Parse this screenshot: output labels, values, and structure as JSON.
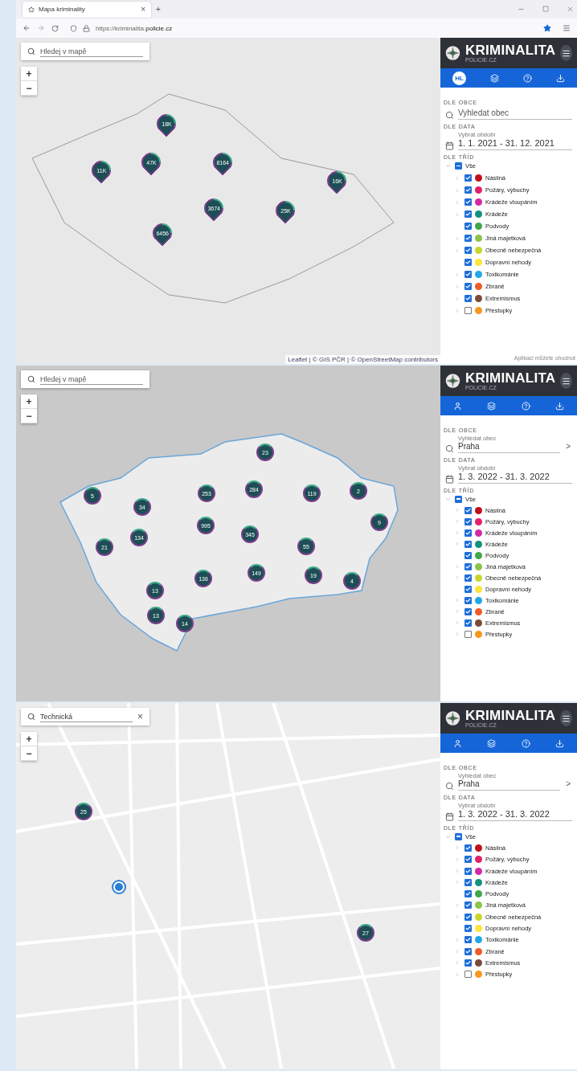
{
  "browser": {
    "tab_title": "Mapa kriminality",
    "tab_close": "×",
    "new_tab": "+",
    "url": "https://kriminalita.**policie.cz**"
  },
  "panels": [
    {
      "map": {
        "search": {
          "placeholder": "Hledej v mapě"
        },
        "zoom_in": "+",
        "zoom_out": "−",
        "attribution": "Leaflet | © GIS PČR | © OpenStreetMap contributors",
        "markers": [
          {
            "kind": "pin",
            "count": "18K"
          },
          {
            "kind": "pin",
            "count": "11K"
          },
          {
            "kind": "pin",
            "count": "47K"
          },
          {
            "kind": "pin",
            "count": "8164"
          },
          {
            "kind": "pin",
            "count": "16K"
          },
          {
            "kind": "pin",
            "count": "3674"
          },
          {
            "kind": "pin",
            "count": "25K"
          },
          {
            "kind": "pin",
            "count": "6456"
          }
        ]
      },
      "sidebar": {
        "brand": "KRIMINALITA",
        "brand_sub": "POLICIE.CZ",
        "toolbar": [
          {
            "kind": "badge",
            "label": "HL"
          },
          {
            "kind": "layers"
          },
          {
            "kind": "help"
          },
          {
            "kind": "download"
          }
        ],
        "municipality": {
          "heading": "DLE OBCE",
          "placeholder": "Vyhledat obec"
        },
        "date": {
          "heading": "DLE DATA",
          "label": "Vybrat období",
          "value": "1. 1. 2021 - 31. 12. 2021"
        },
        "classes": {
          "heading": "DLE TŘÍD",
          "root": {
            "label": "Vše",
            "expanded": true,
            "indeterminate": true,
            "children": [
              {
                "label": "Násilná",
                "color": "#c0101a",
                "checked": true,
                "has_children": true
              },
              {
                "label": "Požáry, výbuchy",
                "color": "#e0216b",
                "checked": true,
                "has_children": true
              },
              {
                "label": "Krádeže vloupáním",
                "color": "#d22aa6",
                "checked": true,
                "has_children": true
              },
              {
                "label": "Krádeže",
                "color": "#13907e",
                "checked": true,
                "has_children": true
              },
              {
                "label": "Podvody",
                "color": "#3ea84a",
                "checked": true,
                "has_children": false
              },
              {
                "label": "Jiná majetková",
                "color": "#8cc34a",
                "checked": true,
                "has_children": true
              },
              {
                "label": "Obecně nebezpečná",
                "color": "#c8d62c",
                "checked": true,
                "has_children": true
              },
              {
                "label": "Dopravní nehody",
                "color": "#fbe53a",
                "checked": true,
                "has_children": false
              },
              {
                "label": "Toxikománie",
                "color": "#22a8e8",
                "checked": true,
                "has_children": true
              },
              {
                "label": "Zbraně",
                "color": "#ee5a2a",
                "checked": true,
                "has_children": true
              },
              {
                "label": "Extremismus",
                "color": "#7a4a3a",
                "checked": true,
                "has_children": true
              },
              {
                "label": "Přestupky",
                "color": "#f7981e",
                "checked": false,
                "has_children": true
              }
            ]
          }
        },
        "footer": "Aplikaci můžete ohodnot"
      }
    },
    {
      "map": {
        "search": {
          "placeholder": "Hledej v mapě"
        },
        "zoom_in": "+",
        "zoom_out": "−",
        "markers": [
          {
            "kind": "cluster",
            "count": "23"
          },
          {
            "kind": "cluster",
            "count": "5"
          },
          {
            "kind": "cluster",
            "count": "34"
          },
          {
            "kind": "cluster",
            "count": "253"
          },
          {
            "kind": "cluster",
            "count": "284"
          },
          {
            "kind": "cluster",
            "count": "119"
          },
          {
            "kind": "cluster",
            "count": "2"
          },
          {
            "kind": "cluster",
            "count": "9"
          },
          {
            "kind": "cluster",
            "count": "134"
          },
          {
            "kind": "cluster",
            "count": "995"
          },
          {
            "kind": "cluster",
            "count": "345"
          },
          {
            "kind": "cluster",
            "count": "55"
          },
          {
            "kind": "cluster",
            "count": "21"
          },
          {
            "kind": "cluster",
            "count": "136"
          },
          {
            "kind": "cluster",
            "count": "149"
          },
          {
            "kind": "cluster",
            "count": "19"
          },
          {
            "kind": "cluster",
            "count": "4"
          },
          {
            "kind": "cluster",
            "count": "13"
          },
          {
            "kind": "cluster",
            "count": "13"
          },
          {
            "kind": "cluster",
            "count": "14"
          }
        ]
      },
      "sidebar": {
        "brand": "KRIMINALITA",
        "brand_sub": "POLICIE.CZ",
        "toolbar": [
          {
            "kind": "user"
          },
          {
            "kind": "layers"
          },
          {
            "kind": "help"
          },
          {
            "kind": "download"
          }
        ],
        "municipality": {
          "heading": "DLE OBCE",
          "label": "Vyhledat obec",
          "value": "Praha",
          "go": ">"
        },
        "date": {
          "heading": "DLE DATA",
          "label": "Vybrat období",
          "value": "1. 3. 2022 - 31. 3. 2022"
        },
        "classes": {
          "heading": "DLE TŘÍD",
          "root": {
            "label": "Vše",
            "expanded": true,
            "indeterminate": true,
            "children": [
              {
                "label": "Násilná",
                "color": "#c0101a",
                "checked": true,
                "has_children": true
              },
              {
                "label": "Požáry, výbuchy",
                "color": "#e0216b",
                "checked": true,
                "has_children": true
              },
              {
                "label": "Krádeže vloupáním",
                "color": "#d22aa6",
                "checked": true,
                "has_children": true
              },
              {
                "label": "Krádeže",
                "color": "#13907e",
                "checked": true,
                "has_children": true
              },
              {
                "label": "Podvody",
                "color": "#3ea84a",
                "checked": true,
                "has_children": false
              },
              {
                "label": "Jiná majetková",
                "color": "#8cc34a",
                "checked": true,
                "has_children": true
              },
              {
                "label": "Obecně nebezpečná",
                "color": "#c8d62c",
                "checked": true,
                "has_children": true
              },
              {
                "label": "Dopravní nehody",
                "color": "#fbe53a",
                "checked": true,
                "has_children": false
              },
              {
                "label": "Toxikománie",
                "color": "#22a8e8",
                "checked": true,
                "has_children": true
              },
              {
                "label": "Zbraně",
                "color": "#ee5a2a",
                "checked": true,
                "has_children": true
              },
              {
                "label": "Extremismus",
                "color": "#7a4a3a",
                "checked": true,
                "has_children": true
              },
              {
                "label": "Přestupky",
                "color": "#f7981e",
                "checked": false,
                "has_children": true
              }
            ]
          }
        }
      }
    },
    {
      "map": {
        "search": {
          "value": "Technická",
          "clear": "×"
        },
        "zoom_in": "+",
        "zoom_out": "−",
        "markers": [
          {
            "kind": "cluster",
            "count": "25"
          },
          {
            "kind": "cluster",
            "count": "27"
          },
          {
            "kind": "location"
          }
        ]
      },
      "sidebar": {
        "brand": "KRIMINALITA",
        "brand_sub": "POLICIE.CZ",
        "toolbar": [
          {
            "kind": "user"
          },
          {
            "kind": "layers"
          },
          {
            "kind": "help"
          },
          {
            "kind": "download"
          }
        ],
        "municipality": {
          "heading": "DLE OBCE",
          "label": "Vyhledat obec",
          "value": "Praha",
          "go": ">"
        },
        "date": {
          "heading": "DLE DATA",
          "label": "Vybrat období",
          "value": "1. 3. 2022 - 31. 3. 2022"
        },
        "classes": {
          "heading": "DLE TŘÍD",
          "root": {
            "label": "Vše",
            "expanded": true,
            "indeterminate": true,
            "children": [
              {
                "label": "Násilná",
                "color": "#c0101a",
                "checked": true,
                "has_children": true
              },
              {
                "label": "Požáry, výbuchy",
                "color": "#e0216b",
                "checked": true,
                "has_children": true
              },
              {
                "label": "Krádeže vloupáním",
                "color": "#d22aa6",
                "checked": true,
                "has_children": true
              },
              {
                "label": "Krádeže",
                "color": "#13907e",
                "checked": true,
                "has_children": true
              },
              {
                "label": "Podvody",
                "color": "#3ea84a",
                "checked": true,
                "has_children": false
              },
              {
                "label": "Jiná majetková",
                "color": "#8cc34a",
                "checked": true,
                "has_children": true
              },
              {
                "label": "Obecně nebezpečná",
                "color": "#c8d62c",
                "checked": true,
                "has_children": true
              },
              {
                "label": "Dopravní nehody",
                "color": "#fbe53a",
                "checked": true,
                "has_children": false
              },
              {
                "label": "Toxikománie",
                "color": "#22a8e8",
                "checked": true,
                "has_children": true
              },
              {
                "label": "Zbraně",
                "color": "#ee5a2a",
                "checked": true,
                "has_children": true
              },
              {
                "label": "Extremismus",
                "color": "#7a4a3a",
                "checked": true,
                "has_children": true
              },
              {
                "label": "Přestupky",
                "color": "#f7981e",
                "checked": false,
                "has_children": true
              }
            ]
          }
        }
      }
    }
  ]
}
